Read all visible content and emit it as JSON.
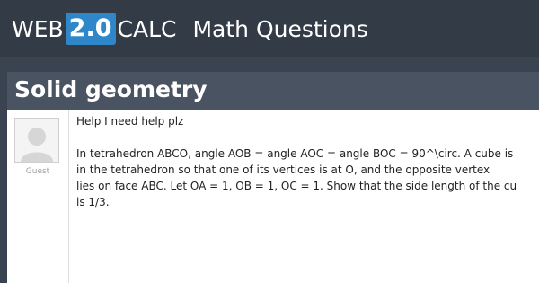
{
  "header": {
    "brand_web": "WEB",
    "brand_version": "2.0",
    "brand_calc": "CALC",
    "section": "Math Questions"
  },
  "question": {
    "title": "Solid geometry",
    "author": "Guest",
    "intro": "Help I need help plz",
    "body_lines": [
      "In tetrahedron ABCO, angle AOB = angle AOC = angle BOC = 90^\\circ. A cube is",
      "in the tetrahedron so that one of its vertices is at O, and the opposite vertex",
      "lies on face ABC. Let OA = 1, OB = 1, OC = 1. Show that the side length of the cu",
      "is 1/3."
    ]
  }
}
